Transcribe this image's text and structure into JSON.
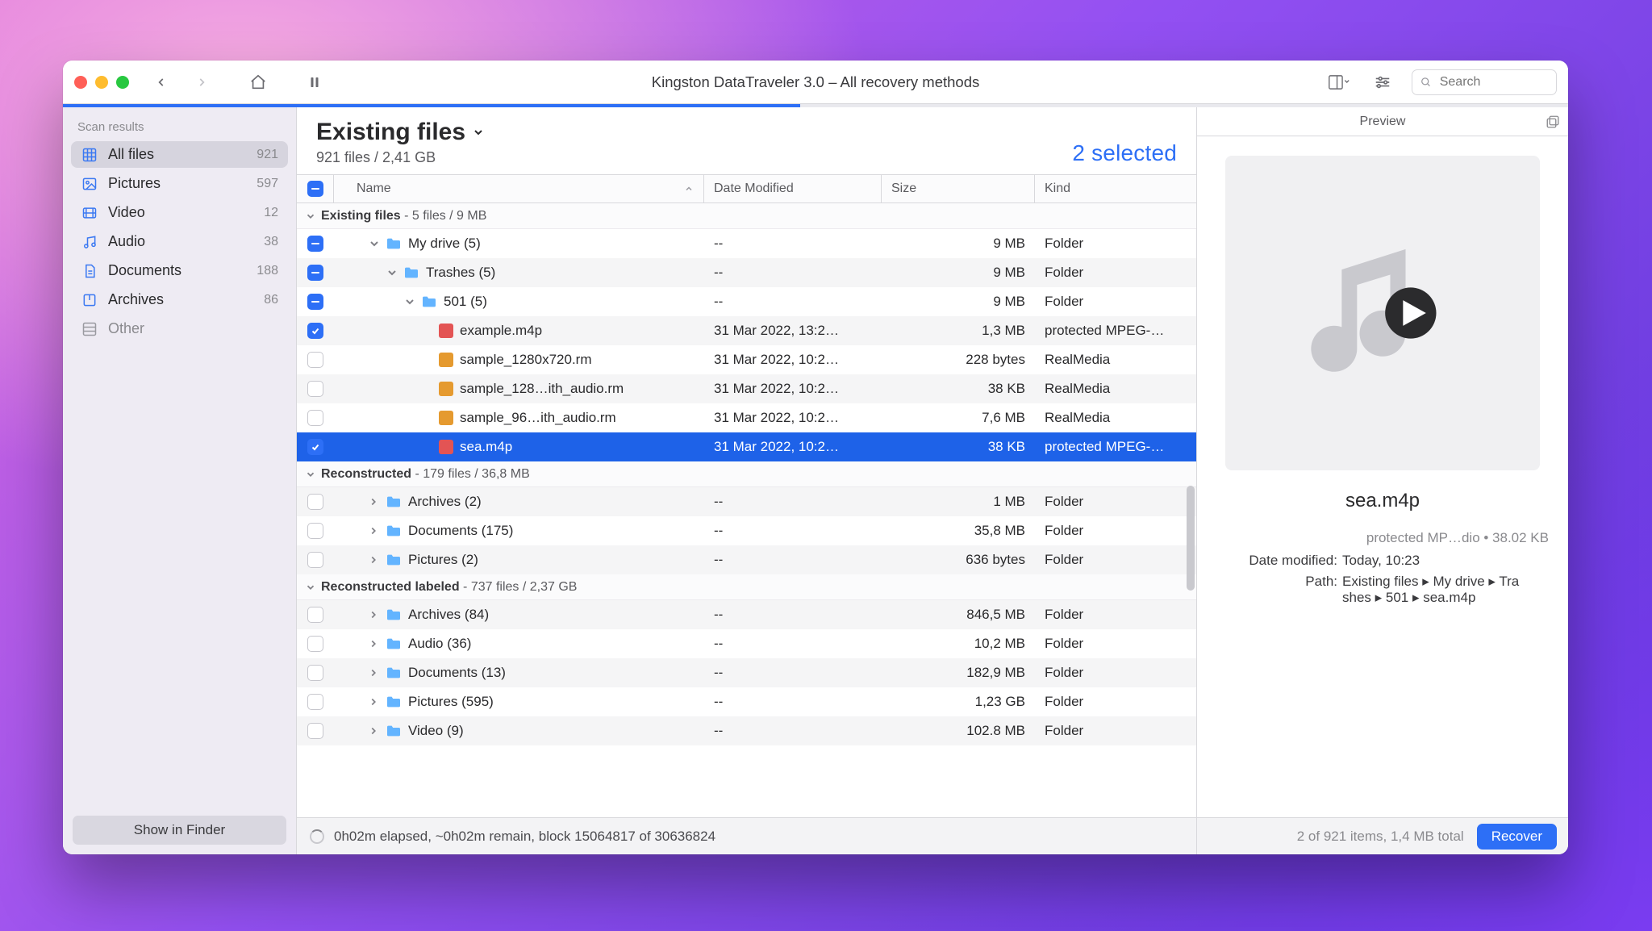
{
  "window": {
    "title": "Kingston DataTraveler 3.0 – All recovery methods",
    "progress_pct": 49
  },
  "search": {
    "placeholder": "Search"
  },
  "sidebar": {
    "heading": "Scan results",
    "items": [
      {
        "icon": "grid",
        "label": "All files",
        "count": "921",
        "selected": true
      },
      {
        "icon": "image",
        "label": "Pictures",
        "count": "597"
      },
      {
        "icon": "video",
        "label": "Video",
        "count": "12"
      },
      {
        "icon": "music",
        "label": "Audio",
        "count": "38"
      },
      {
        "icon": "doc",
        "label": "Documents",
        "count": "188"
      },
      {
        "icon": "archive",
        "label": "Archives",
        "count": "86"
      },
      {
        "icon": "other",
        "label": "Other",
        "count": ""
      }
    ],
    "show_in_finder": "Show in Finder"
  },
  "list": {
    "title": "Existing files",
    "subtitle": "921 files / 2,41 GB",
    "selected_label": "2 selected",
    "columns": {
      "check": "",
      "name": "Name",
      "date": "Date Modified",
      "size": "Size",
      "kind": "Kind"
    },
    "header_check_state": "mixed",
    "groups": [
      {
        "title_bold": "Existing files",
        "title_rest": " - 5 files / 9 MB",
        "rows": [
          {
            "check": "mixed",
            "indent": 1,
            "expander": "down",
            "type": "folder",
            "name": "My drive (5)",
            "date": "--",
            "size": "9 MB",
            "kind": "Folder"
          },
          {
            "check": "mixed",
            "indent": 2,
            "expander": "down",
            "type": "folder",
            "name": "Trashes (5)",
            "date": "--",
            "size": "9 MB",
            "kind": "Folder"
          },
          {
            "check": "mixed",
            "indent": 3,
            "expander": "down",
            "type": "folder",
            "name": "501 (5)",
            "date": "--",
            "size": "9 MB",
            "kind": "Folder"
          },
          {
            "check": "on",
            "indent": 4,
            "type": "file",
            "ico": "red",
            "name": "example.m4p",
            "date": "31 Mar 2022, 13:2…",
            "size": "1,3 MB",
            "kind": "protected MPEG-…"
          },
          {
            "check": "off",
            "indent": 4,
            "type": "file",
            "ico": "orange",
            "name": "sample_1280x720.rm",
            "date": "31 Mar 2022, 10:2…",
            "size": "228 bytes",
            "kind": "RealMedia"
          },
          {
            "check": "off",
            "indent": 4,
            "type": "file",
            "ico": "orange",
            "name": "sample_128…ith_audio.rm",
            "date": "31 Mar 2022, 10:2…",
            "size": "38 KB",
            "kind": "RealMedia"
          },
          {
            "check": "off",
            "indent": 4,
            "type": "file",
            "ico": "orange",
            "name": "sample_96…ith_audio.rm",
            "date": "31 Mar 2022, 10:2…",
            "size": "7,6 MB",
            "kind": "RealMedia"
          },
          {
            "check": "on",
            "indent": 4,
            "type": "file",
            "ico": "red",
            "name": "sea.m4p",
            "date": "31 Mar 2022, 10:2…",
            "size": "38 KB",
            "kind": "protected MPEG-…",
            "selected": true
          }
        ]
      },
      {
        "title_bold": "Reconstructed",
        "title_rest": " - 179 files / 36,8 MB",
        "rows": [
          {
            "check": "off",
            "indent": 1,
            "expander": "right",
            "type": "folder",
            "name": "Archives (2)",
            "date": "--",
            "size": "1 MB",
            "kind": "Folder"
          },
          {
            "check": "off",
            "indent": 1,
            "expander": "right",
            "type": "folder",
            "name": "Documents (175)",
            "date": "--",
            "size": "35,8 MB",
            "kind": "Folder"
          },
          {
            "check": "off",
            "indent": 1,
            "expander": "right",
            "type": "folder",
            "name": "Pictures (2)",
            "date": "--",
            "size": "636 bytes",
            "kind": "Folder"
          }
        ]
      },
      {
        "title_bold": "Reconstructed labeled",
        "title_rest": " - 737 files / 2,37 GB",
        "rows": [
          {
            "check": "off",
            "indent": 1,
            "expander": "right",
            "type": "folder",
            "name": "Archives (84)",
            "date": "--",
            "size": "846,5 MB",
            "kind": "Folder"
          },
          {
            "check": "off",
            "indent": 1,
            "expander": "right",
            "type": "folder",
            "name": "Audio (36)",
            "date": "--",
            "size": "10,2 MB",
            "kind": "Folder"
          },
          {
            "check": "off",
            "indent": 1,
            "expander": "right",
            "type": "folder",
            "name": "Documents (13)",
            "date": "--",
            "size": "182,9 MB",
            "kind": "Folder"
          },
          {
            "check": "off",
            "indent": 1,
            "expander": "right",
            "type": "folder",
            "name": "Pictures (595)",
            "date": "--",
            "size": "1,23 GB",
            "kind": "Folder"
          },
          {
            "check": "off",
            "indent": 1,
            "expander": "right",
            "type": "folder",
            "name": "Video (9)",
            "date": "--",
            "size": "102.8 MB",
            "kind": "Folder"
          }
        ]
      }
    ]
  },
  "footer_status": "0h02m elapsed, ~0h02m remain, block 15064817 of 30636824",
  "preview": {
    "header": "Preview",
    "filename": "sea.m4p",
    "kind_size": "protected MP…dio • 38.02 KB",
    "labels": {
      "date": "Date modified:",
      "path": "Path:"
    },
    "date_modified": "Today, 10:23",
    "path": "Existing files ▸ My drive ▸ Tra shes ▸ 501 ▸ sea.m4p",
    "selection_summary": "2 of 921 items, 1,4 MB total",
    "recover_label": "Recover"
  }
}
